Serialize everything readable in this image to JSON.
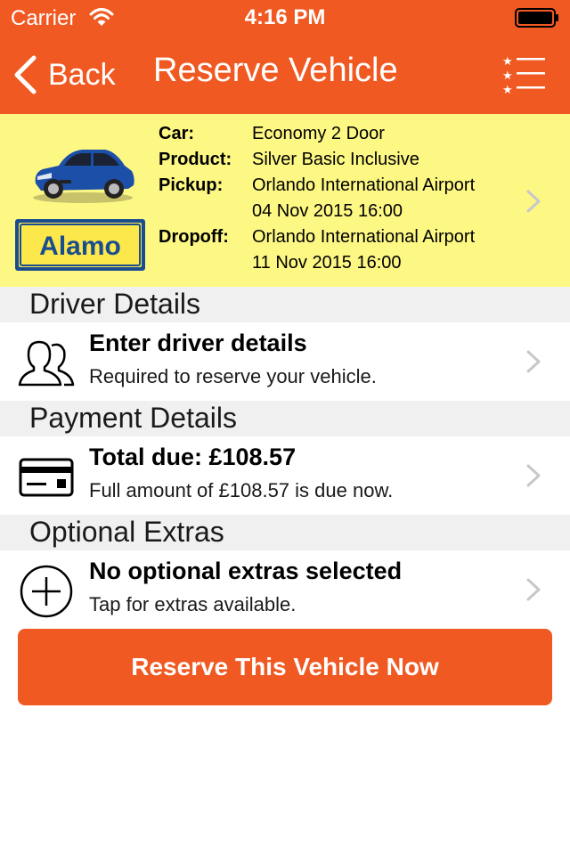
{
  "status_bar": {
    "carrier": "Carrier",
    "time": "4:16 PM",
    "wifi_icon": "wifi-icon",
    "battery_icon": "battery-icon"
  },
  "nav": {
    "back_label": "Back",
    "title": "Reserve Vehicle",
    "menu_icon": "starred-list-icon"
  },
  "colors": {
    "brand": "#f05a22",
    "summary_bg": "#fdf784",
    "section_bg": "#f0f0f0"
  },
  "vehicle": {
    "labels": {
      "car": "Car:",
      "product": "Product:",
      "pickup": "Pickup:",
      "dropoff": "Dropoff:"
    },
    "car": "Economy 2 Door",
    "product": "Silver Basic Inclusive",
    "pickup_location": "Orlando International Airport",
    "pickup_datetime": "04 Nov 2015 16:00",
    "dropoff_location": "Orlando International Airport",
    "dropoff_datetime": "11 Nov 2015 16:00",
    "supplier_logo_text": "Alamo"
  },
  "sections": {
    "driver": {
      "header": "Driver Details",
      "title": "Enter driver details",
      "subtitle": "Required to reserve your vehicle.",
      "icon": "people-icon"
    },
    "payment": {
      "header": "Payment Details",
      "title": "Total due: £108.57",
      "subtitle": "Full amount of £108.57 is due now.",
      "icon": "credit-card-icon"
    },
    "extras": {
      "header": "Optional Extras",
      "title": "No optional extras selected",
      "subtitle": "Tap for extras available.",
      "icon": "plus-circle-icon"
    }
  },
  "reserve_button": {
    "label": "Reserve This Vehicle Now"
  }
}
